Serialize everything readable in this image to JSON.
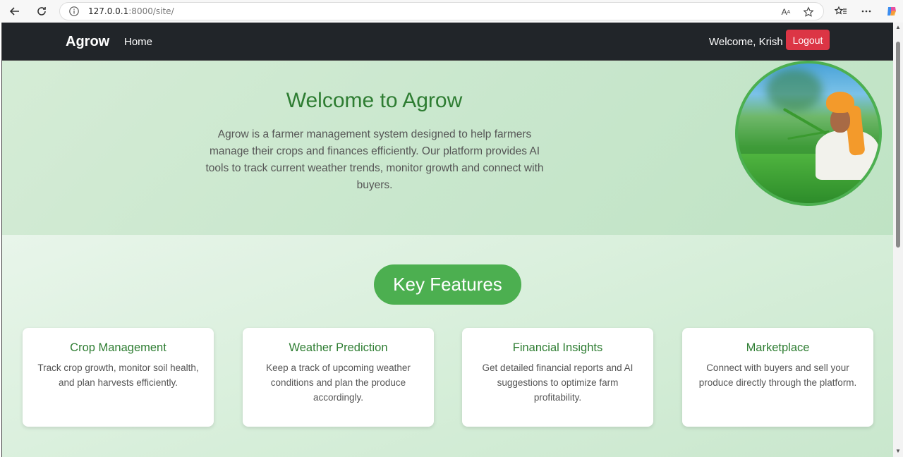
{
  "browser": {
    "url_host": "127.0.0.1",
    "url_path": ":8000/site/"
  },
  "navbar": {
    "brand": "Agrow",
    "home_label": "Home",
    "welcome_text": "Welcome, Krish",
    "logout_label": "Logout"
  },
  "hero": {
    "title": "Welcome to Agrow",
    "description": "Agrow is a farmer management system designed to help farmers manage their crops and finances efficiently. Our platform provides AI tools to track current weather trends, monitor growth and connect with buyers."
  },
  "features": {
    "heading": "Key Features",
    "cards": [
      {
        "title": "Crop Management",
        "desc": "Track crop growth, monitor soil health, and plan harvests efficiently."
      },
      {
        "title": "Weather Prediction",
        "desc": "Keep a track of upcoming weather conditions and plan the produce accordingly."
      },
      {
        "title": "Financial Insights",
        "desc": "Get detailed financial reports and AI suggestions to optimize farm profitability."
      },
      {
        "title": "Marketplace",
        "desc": "Connect with buyers and sell your produce directly through the platform."
      }
    ]
  },
  "colors": {
    "navbar_bg": "#212529",
    "accent_green": "#4caf50",
    "title_green": "#2e7d32",
    "logout_red": "#dc3545"
  }
}
